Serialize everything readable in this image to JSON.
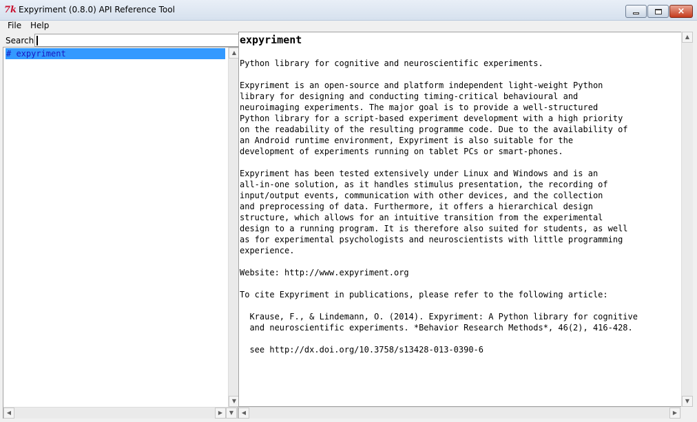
{
  "window": {
    "title": "Expyriment (0.8.0) API Reference Tool",
    "icon_text": "7k",
    "minimize": "minimize",
    "maximize": "maximize",
    "close": "×"
  },
  "menu": {
    "file": "File",
    "help": "Help"
  },
  "search": {
    "label": "Search:",
    "value": ""
  },
  "tree": {
    "items": [
      {
        "label": "# expyriment",
        "selected": true
      }
    ]
  },
  "doc": {
    "title": "expyriment",
    "lines": [
      "Python library for cognitive and neuroscientific experiments.",
      "",
      "Expyriment is an open-source and platform independent light-weight Python",
      "library for designing and conducting timing-critical behavioural and",
      "neuroimaging experiments. The major goal is to provide a well-structured",
      "Python library for a script-based experiment development with a high priority",
      "on the readability of the resulting programme code. Due to the availability of",
      "an Android runtime environment, Expyriment is also suitable for the",
      "development of experiments running on tablet PCs or smart-phones.",
      "",
      "Expyriment has been tested extensively under Linux and Windows and is an",
      "all-in-one solution, as it handles stimulus presentation, the recording of",
      "input/output events, communication with other devices, and the collection",
      "and preprocessing of data. Furthermore, it offers a hierarchical design",
      "structure, which allows for an intuitive transition from the experimental",
      "design to a running program. It is therefore also suited for students, as well",
      "as for experimental psychologists and neuroscientists with little programming",
      "experience.",
      "",
      "Website: http://www.expyriment.org",
      "",
      "To cite Expyriment in publications, please refer to the following article:",
      "",
      "  Krause, F., & Lindemann, O. (2014). Expyriment: A Python library for cognitive",
      "  and neuroscientific experiments. *Behavior Research Methods*, 46(2), 416-428.",
      "",
      "  see http://dx.doi.org/10.3758/s13428-013-0390-6"
    ]
  },
  "scroll": {
    "up": "▲",
    "down": "▼",
    "left": "◀",
    "right": "▶"
  }
}
